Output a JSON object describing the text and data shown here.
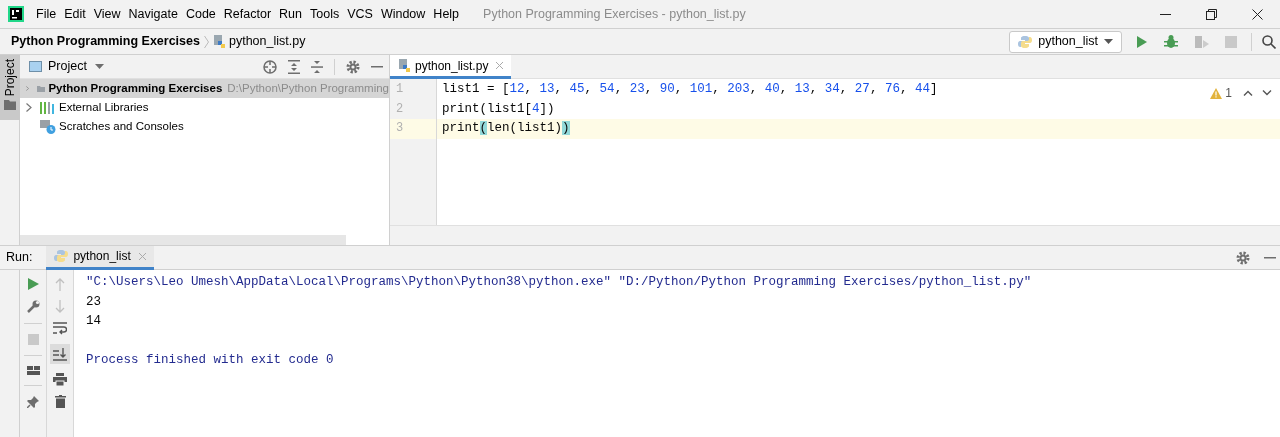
{
  "window": {
    "title": "Python Programming Exercises - python_list.py",
    "menu": [
      "File",
      "Edit",
      "View",
      "Navigate",
      "Code",
      "Refactor",
      "Run",
      "Tools",
      "VCS",
      "Window",
      "Help"
    ]
  },
  "breadcrumb": [
    "Python Programming Exercises",
    "python_list.py"
  ],
  "run_config": {
    "label": "python_list"
  },
  "side_tab": {
    "label": "Project",
    "selected": true
  },
  "project": {
    "title": "Project",
    "items": [
      {
        "label": "Python Programming Exercises",
        "path": "D:\\Python\\Python Programming",
        "kind": "folder",
        "expandable": true,
        "selected": true
      },
      {
        "label": "External Libraries",
        "kind": "libraries",
        "expandable": true,
        "selected": false
      },
      {
        "label": "Scratches and Consoles",
        "kind": "scratches",
        "expandable": false,
        "selected": false
      }
    ]
  },
  "editor": {
    "tabs": [
      {
        "label": "python_list.py",
        "selected": true
      }
    ],
    "warnings": "1",
    "lines": [
      {
        "number": "1",
        "current": false,
        "tokens": [
          {
            "text": "list1 = [",
            "kind": "plain"
          },
          {
            "text": "12",
            "kind": "number"
          },
          {
            "text": ", ",
            "kind": "plain"
          },
          {
            "text": "13",
            "kind": "number"
          },
          {
            "text": ", ",
            "kind": "plain"
          },
          {
            "text": "45",
            "kind": "number"
          },
          {
            "text": ", ",
            "kind": "plain"
          },
          {
            "text": "54",
            "kind": "number"
          },
          {
            "text": ", ",
            "kind": "plain"
          },
          {
            "text": "23",
            "kind": "number"
          },
          {
            "text": ", ",
            "kind": "plain"
          },
          {
            "text": "90",
            "kind": "number"
          },
          {
            "text": ", ",
            "kind": "plain"
          },
          {
            "text": "101",
            "kind": "number"
          },
          {
            "text": ", ",
            "kind": "plain"
          },
          {
            "text": "203",
            "kind": "number"
          },
          {
            "text": ", ",
            "kind": "plain"
          },
          {
            "text": "40",
            "kind": "number"
          },
          {
            "text": ", ",
            "kind": "plain"
          },
          {
            "text": "13",
            "kind": "number"
          },
          {
            "text": ", ",
            "kind": "plain"
          },
          {
            "text": "34",
            "kind": "number"
          },
          {
            "text": ", ",
            "kind": "plain"
          },
          {
            "text": "27",
            "kind": "number"
          },
          {
            "text": ", ",
            "kind": "plain"
          },
          {
            "text": "76",
            "kind": "number"
          },
          {
            "text": ", ",
            "kind": "plain"
          },
          {
            "text": "44",
            "kind": "number"
          },
          {
            "text": "]",
            "kind": "plain"
          }
        ]
      },
      {
        "number": "2",
        "current": false,
        "tokens": [
          {
            "text": "print(list1[",
            "kind": "plain"
          },
          {
            "text": "4",
            "kind": "number"
          },
          {
            "text": "])",
            "kind": "plain"
          }
        ]
      },
      {
        "number": "3",
        "current": true,
        "tokens": [
          {
            "text": "print",
            "kind": "plain"
          },
          {
            "text": "(",
            "kind": "brace_match"
          },
          {
            "text": "len(list1)",
            "kind": "plain"
          },
          {
            "text": ")",
            "kind": "brace_match"
          }
        ]
      }
    ]
  },
  "run": {
    "label": "Run:",
    "tabs": [
      {
        "label": "python_list",
        "selected": true
      }
    ],
    "console": [
      {
        "kind": "command",
        "text": "\"C:\\Users\\Leo Umesh\\AppData\\Local\\Programs\\Python\\Python38\\python.exe\" \"D:/Python/Python Programming Exercises/python_list.py\""
      },
      {
        "kind": "output",
        "text": "23"
      },
      {
        "kind": "output",
        "text": "14"
      },
      {
        "kind": "blank"
      },
      {
        "kind": "info",
        "text": "Process finished with exit code 0"
      }
    ]
  }
}
